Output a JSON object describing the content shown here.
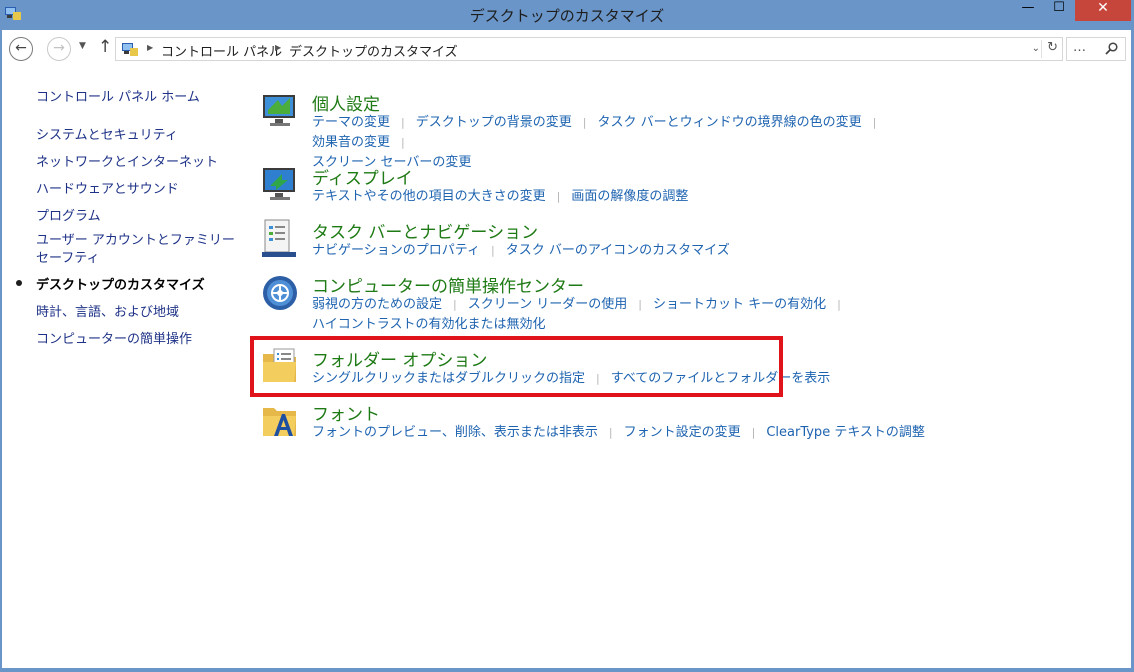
{
  "window": {
    "title": "デスクトップのカスタマイズ",
    "minimize_glyph": "—",
    "maximize_glyph": "☐",
    "close_glyph": "✕"
  },
  "nav": {
    "back_glyph": "←",
    "forward_glyph": "→",
    "recent_glyph": "▼",
    "up_glyph": "↑",
    "breadcrumb": [
      "コントロール パネル",
      "デスクトップのカスタマイズ"
    ],
    "crumb_sep_glyph": "▶",
    "address_dropdown_glyph": "⌄",
    "refresh_glyph": "↻",
    "search_placeholder": "…"
  },
  "sidebar": {
    "home": "コントロール パネル ホーム",
    "items": [
      {
        "label": "システムとセキュリティ"
      },
      {
        "label": "ネットワークとインターネット"
      },
      {
        "label": "ハードウェアとサウンド"
      },
      {
        "label": "プログラム"
      },
      {
        "label": "ユーザー アカウントとファミリー セーフティ"
      },
      {
        "label": "デスクトップのカスタマイズ",
        "current": true
      },
      {
        "label": "時計、言語、および地域"
      },
      {
        "label": "コンピューターの簡単操作"
      }
    ]
  },
  "categories": [
    {
      "title": "個人設定",
      "icon": "personalization-icon",
      "links": [
        "テーマの変更",
        "デスクトップの背景の変更",
        "タスク バーとウィンドウの境界線の色の変更",
        "効果音の変更",
        "スクリーン セーバーの変更"
      ]
    },
    {
      "title": "ディスプレイ",
      "icon": "display-icon",
      "links": [
        "テキストやその他の項目の大きさの変更",
        "画面の解像度の調整"
      ]
    },
    {
      "title": "タスク バーとナビゲーション",
      "icon": "taskbar-icon",
      "links": [
        "ナビゲーションのプロパティ",
        "タスク バーのアイコンのカスタマイズ"
      ]
    },
    {
      "title": "コンピューターの簡単操作センター",
      "icon": "ease-of-access-icon",
      "links": [
        "弱視の方のための設定",
        "スクリーン リーダーの使用",
        "ショートカット キーの有効化",
        "ハイコントラストの有効化または無効化"
      ]
    },
    {
      "title": "フォルダー オプション",
      "icon": "folder-options-icon",
      "links": [
        "シングルクリックまたはダブルクリックの指定",
        "すべてのファイルとフォルダーを表示"
      ]
    },
    {
      "title": "フォント",
      "icon": "fonts-icon",
      "links": [
        "フォントのプレビュー、削除、表示または非表示",
        "フォント設定の変更",
        "ClearType テキストの調整"
      ]
    }
  ],
  "colors": {
    "titlebar": "#6a95c8",
    "category_title": "#1e7a14",
    "link": "#1e63b0",
    "sidebar_link": "#1e3287",
    "highlight": "#e0131a",
    "close_button": "#c7463c"
  }
}
